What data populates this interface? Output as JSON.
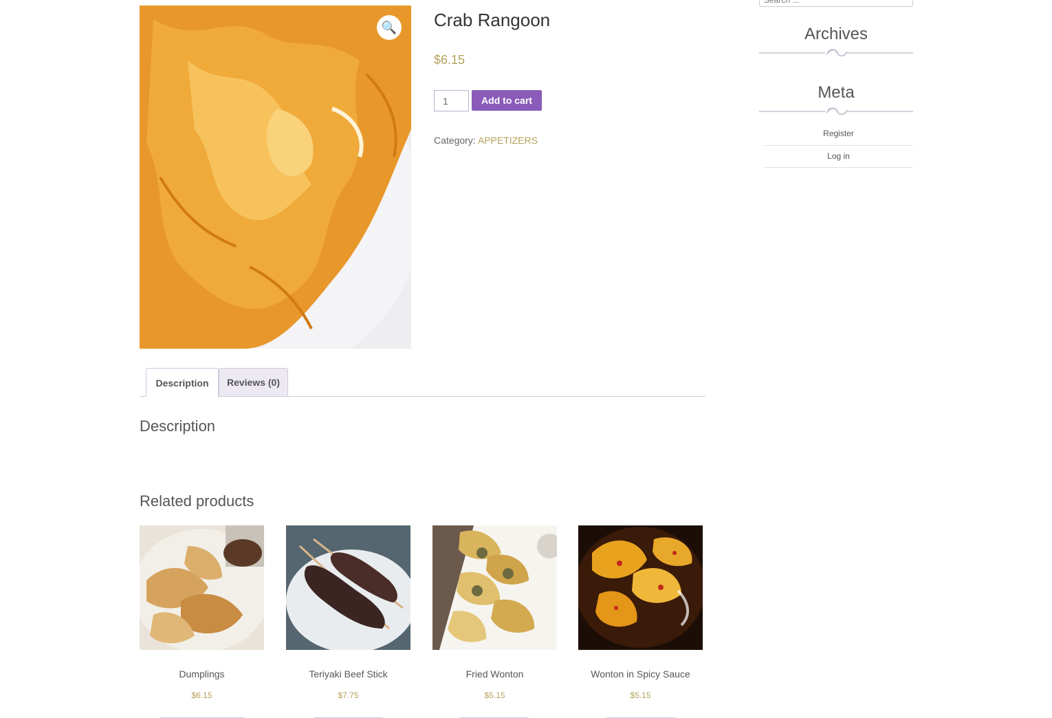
{
  "product": {
    "title": "Crab Rangoon",
    "price": "$6.15",
    "quantity": "1",
    "add_to_cart_label": "Add to cart",
    "category_label": "Category:",
    "category_value": "APPETIZERS",
    "zoom_icon": "magnifier-icon"
  },
  "tabs": [
    {
      "label": "Description",
      "active": true
    },
    {
      "label": "Reviews (0)",
      "active": false
    }
  ],
  "description_heading": "Description",
  "related": {
    "heading": "Related products",
    "items": [
      {
        "name": "Dumplings",
        "price": "$6.15"
      },
      {
        "name": "Teriyaki Beef Stick",
        "price": "$7.75"
      },
      {
        "name": "Fried Wonton",
        "price": "$5.15"
      },
      {
        "name": "Wonton in Spicy Sauce",
        "price": "$5.15"
      }
    ]
  },
  "sidebar": {
    "search_placeholder": "Search ...",
    "archives_title": "Archives",
    "meta_title": "Meta",
    "meta_links": [
      "Register",
      "Log in"
    ]
  },
  "colors": {
    "accent_purple": "#8a5bb8",
    "price_gold": "#b5a15a",
    "tab_border": "#cfc9de"
  }
}
